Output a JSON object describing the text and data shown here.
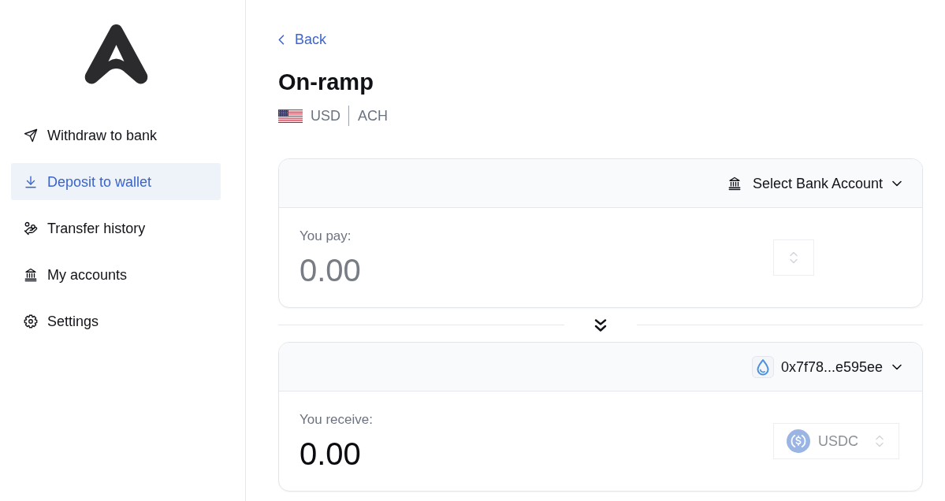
{
  "sidebar": {
    "items": [
      {
        "kind": "withdraw",
        "label": "Withdraw to bank",
        "selected": false
      },
      {
        "kind": "deposit",
        "label": "Deposit to wallet",
        "selected": true
      },
      {
        "kind": "history",
        "label": "Transfer history",
        "selected": false
      },
      {
        "kind": "accounts",
        "label": "My accounts",
        "selected": false
      },
      {
        "kind": "settings",
        "label": "Settings",
        "selected": false
      }
    ]
  },
  "back_link": {
    "label": "Back"
  },
  "title": "On-ramp",
  "currency": {
    "code": "USD",
    "method": "ACH"
  },
  "cards": [
    {
      "header": {
        "kind": "bank",
        "label": "Select Bank Account"
      },
      "label": "You pay:",
      "amount": {
        "placeholder": "0.00"
      },
      "token_select": {
        "disabled": true
      }
    },
    {
      "header": {
        "kind": "wallet",
        "label": "0x7f78...e595ee"
      },
      "label": "You receive:",
      "amount": {
        "value": "0.00"
      },
      "token_select": {
        "label": "USDC",
        "disabled": true
      }
    }
  ]
}
